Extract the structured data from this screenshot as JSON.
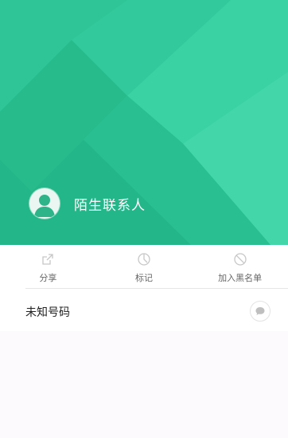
{
  "header": {
    "contact_name": "陌生联系人",
    "background_color": "#2fc596"
  },
  "actions": [
    {
      "label": "分享",
      "icon": "share-icon"
    },
    {
      "label": "标记",
      "icon": "tag-icon"
    },
    {
      "label": "加入黑名单",
      "icon": "block-icon"
    }
  ],
  "number_row": {
    "text": "未知号码",
    "button_icon": "message-icon"
  }
}
